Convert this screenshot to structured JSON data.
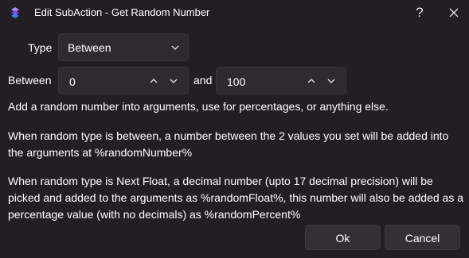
{
  "window": {
    "title": "Edit SubAction - Get Random Number",
    "help_glyph": "?",
    "icons": {
      "app": "streamerbot-logo-icon",
      "help": "question-mark-icon",
      "close": "close-icon"
    }
  },
  "form": {
    "type_label": "Type",
    "type_value": "Between",
    "between_label": "Between",
    "min_value": "0",
    "and_label": "and",
    "max_value": "100"
  },
  "description": {
    "line1": "Add a random number into arguments, use for percentages, or anything else.",
    "line2": "When random type is between, a number between the 2 values you set will be added into the arguments at %randomNumber%",
    "line3": "When random type is Next Float, a decimal number (upto 17 decimal precision) will be picked and added to the arguments as %randomFloat%, this number will also be added as a percentage value (with no decimals) as %randomPercent%"
  },
  "buttons": {
    "ok": "Ok",
    "cancel": "Cancel"
  },
  "colors": {
    "background": "#231d24",
    "control": "#2f2a31",
    "button": "#342e36",
    "logo_purple": "#8b5cf6",
    "logo_blue": "#3b82f6"
  }
}
